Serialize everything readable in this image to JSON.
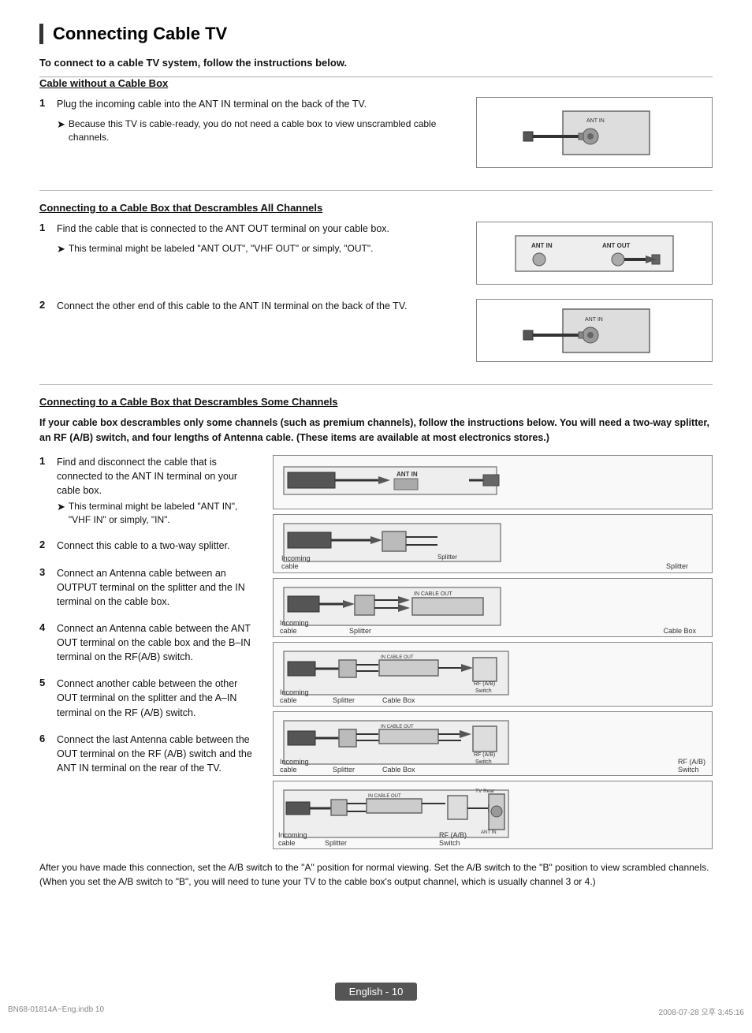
{
  "page": {
    "title": "Connecting Cable TV",
    "subtitle": "To connect to a cable TV system, follow the instructions below.",
    "section1": {
      "title": "Cable without a Cable Box",
      "step1": {
        "num": "1",
        "text": "Plug the incoming cable into the ANT IN terminal on the back of the TV.",
        "note": "Because this TV is cable-ready, you do not need a cable box to view unscrambled cable channels."
      }
    },
    "section2": {
      "title": "Connecting to a Cable Box that Descrambles All Channels",
      "step1": {
        "num": "1",
        "text": "Find the cable that is connected to the ANT OUT terminal on your cable box.",
        "note": "This terminal might be labeled \"ANT OUT\", \"VHF OUT\" or simply, \"OUT\"."
      },
      "step2": {
        "num": "2",
        "text": "Connect the other end of this cable to the ANT IN terminal on the back of the TV."
      }
    },
    "section3": {
      "title": "Connecting to a Cable Box that Descrambles Some Channels",
      "intro": "If your cable box descrambles only some channels (such as premium channels), follow the instructions below. You will need a two-way splitter, an RF (A/B) switch, and four lengths of Antenna cable. (These items are available at most electronics stores.)",
      "steps": [
        {
          "num": "1",
          "text": "Find and disconnect the cable that is connected to the ANT IN terminal on your cable box.",
          "note": "This terminal might be labeled \"ANT IN\", \"VHF IN\" or simply, \"IN\"."
        },
        {
          "num": "2",
          "text": "Connect this cable to a two-way splitter."
        },
        {
          "num": "3",
          "text": "Connect an Antenna cable between an OUTPUT terminal on the splitter and the IN terminal on the cable box."
        },
        {
          "num": "4",
          "text": "Connect an Antenna cable between the ANT OUT terminal on the cable box and the B–IN terminal on the RF(A/B) switch."
        },
        {
          "num": "5",
          "text": "Connect another cable between the other OUT terminal on the splitter and the A–IN terminal on the RF (A/B) switch."
        },
        {
          "num": "6",
          "text": "Connect the last Antenna cable between the OUT terminal on the RF (A/B) switch and the ANT IN terminal on the rear of the TV."
        }
      ]
    },
    "after_note": "After you have made this connection, set the A/B switch to the \"A\" position for normal viewing. Set the A/B switch to the \"B\" position to view scrambled channels. (When you set the A/B switch to \"B\", you will need to tune your TV to the cable box's output channel, which is usually channel 3 or 4.)",
    "footer": {
      "badge": "English - 10",
      "left": "BN68-01814A~Eng.indb   10",
      "right": "2008-07-28   오후 3:45:16"
    }
  }
}
